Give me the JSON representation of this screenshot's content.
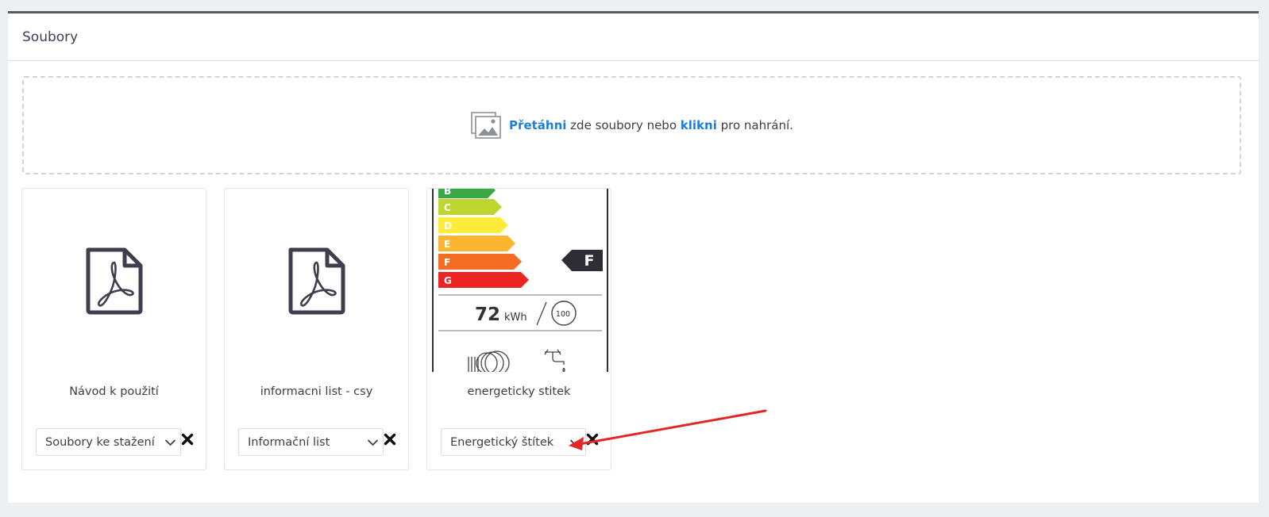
{
  "panel": {
    "title": "Soubory"
  },
  "dropzone": {
    "drag_link": "Přetáhni",
    "text_middle": " zde soubory nebo ",
    "click_link": "klikni",
    "text_end": " pro nahrání.",
    "link_color": "#1e7fd6"
  },
  "files": [
    {
      "name": "Návod k použití",
      "type_value": "Soubory ke stažení",
      "preview": "pdf-icon"
    },
    {
      "name": "informacni list - csy",
      "type_value": "Informační list",
      "preview": "pdf-icon"
    },
    {
      "name": "energeticky stitek",
      "type_value": "Energetický štítek",
      "preview": "energy-label-image",
      "energy_label": {
        "classes": [
          "B",
          "C",
          "D",
          "E",
          "F",
          "G"
        ],
        "class_colors": [
          "#3aa845",
          "#bed630",
          "#fdeb3c",
          "#fcb530",
          "#f46d23",
          "#ec2424"
        ],
        "rating": "F",
        "consumption_value": "72",
        "consumption_unit": "kWh",
        "cycles": "100"
      }
    }
  ],
  "annotation": {
    "arrow_color": "#e32727"
  }
}
